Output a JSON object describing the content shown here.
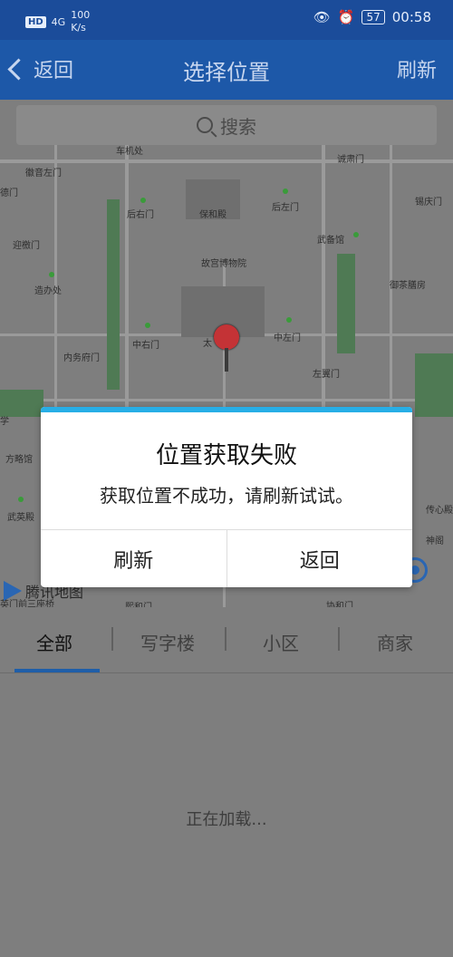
{
  "status_bar": {
    "network_badge": "HD",
    "signal": "4G",
    "speed_value": "100",
    "speed_unit": "K/s",
    "battery": "57",
    "time": "00:58"
  },
  "nav": {
    "back_label": "返回",
    "title": "选择位置",
    "refresh_label": "刷新"
  },
  "search": {
    "placeholder": "搜索"
  },
  "map": {
    "labels": [
      "车机处",
      "诚肃门",
      "徽音左门",
      "德门",
      "后右门",
      "保和殿",
      "后左门",
      "锡庆门",
      "故宫博物院",
      "迎檄门",
      "武备馆",
      "造办处",
      "御茶膳房",
      "中右门",
      "太",
      "中左门",
      "内务府门",
      "左翼门",
      "学",
      "方略馆",
      "传心殿",
      "武英殿",
      "神阁",
      "英门前三座桥",
      "熙和门",
      "协和门"
    ],
    "attribution": "腾讯地图"
  },
  "tabs": [
    {
      "label": "全部"
    },
    {
      "label": "写字楼"
    },
    {
      "label": "小区"
    },
    {
      "label": "商家"
    }
  ],
  "loading_text": "正在加载...",
  "dialog": {
    "title": "位置获取失败",
    "message": "获取位置不成功，请刷新试试。",
    "refresh_button": "刷新",
    "back_button": "返回"
  },
  "colors": {
    "accent": "#1d58a8",
    "dialog_bar": "#27aee6",
    "pin": "#c43336"
  }
}
